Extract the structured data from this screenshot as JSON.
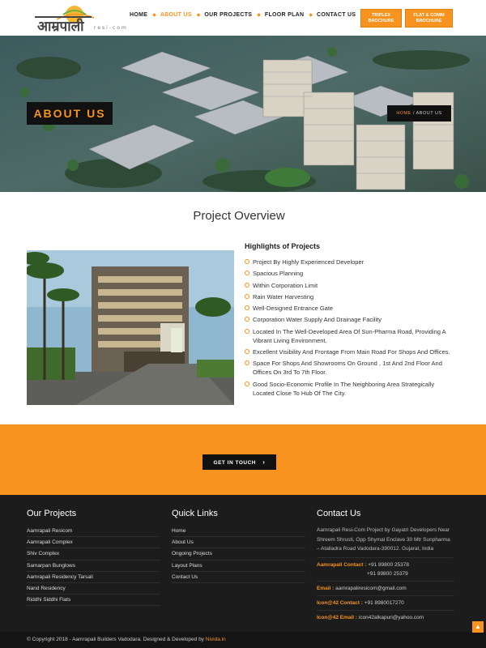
{
  "logo": {
    "text": "आम्रपाली",
    "sub": "resi-com"
  },
  "nav": [
    "HOME",
    "ABOUT US",
    "OUR PROJECTS",
    "FLOOR PLAN",
    "CONTACT US"
  ],
  "brochures": [
    {
      "line1": "TRIPLEX",
      "line2": "BROCHURE"
    },
    {
      "line1": "FLAT & COMM",
      "line2": "BROCHURE"
    }
  ],
  "hero": {
    "title": "ABOUT US",
    "crumb_home": "HOME",
    "crumb_sep": "/",
    "crumb_current": "ABOUT US"
  },
  "overview": {
    "title": "Project Overview",
    "highlights_title": "Highlights of Projects",
    "highlights": [
      "Project By Highly Experienced Developer",
      "Spacious Planning",
      "Within Corporation Limit",
      "Rain Water Harvesting",
      "Well-Designed Entrance Gate",
      "Corporation Water Supply And Drainage Facility",
      "Located In The Well-Developed Area Of Sun-Pharma Road, Providing A Vibrant Living Environment.",
      "Excellent Visibility And Frontage From Main Road For Shops And Offices.",
      "Space For Shops And Showrooms On Ground , 1st And 2nd Floor And Offices On 3rd To 7th Floor.",
      "Good Socio-Economic Profile In The Neighboring Area Strategically Located Close To Hub Of The City."
    ]
  },
  "cta": {
    "label": "GET IN TOUCH",
    "icon": "chevron-right-icon"
  },
  "footer": {
    "projects_title": "Our Projects",
    "projects": [
      "Aamrapali Resicom",
      "Aamrapali Complex",
      "Shiv Complex",
      "Samarpan Bunglows",
      "Aamrapali Residency Tarsali",
      "Nand Residency",
      "Riddhi Siddhi Flats"
    ],
    "links_title": "Quick Links",
    "links": [
      "Home",
      "About Us",
      "Ongoing Projects",
      "Layout Plans",
      "Contact Us"
    ],
    "contact_title": "Contact Us",
    "address": "Aamrapali Resi-Com Project by Gayatri Developers Near Shreem Shrusti, Opp Shymal Enclave 30 Mtr Sunpharma – Atalladra Road Vadodara-390012. Gujarat, India",
    "contact_label": "Aamrapali Contact :",
    "phone1": "+91 89800 25378",
    "phone2": "+91 89800 25379",
    "email_label": "Email :",
    "email": "aamrapaliresicom@gmail.com",
    "icon_contact_label": "Icon@42 Contact :",
    "icon_phone": "+91 8980017270",
    "icon_email_label": "Icon@42 Email :",
    "icon_email": "icon42alkapuri@yahoo.com"
  },
  "copyright": {
    "text": "© Copyright 2018 - Aamrapali Builders Vadodara. Designed & Developed by",
    "brand": "Nivida.in"
  },
  "colors": {
    "accent": "#f7931e",
    "footer": "#1c1c1c",
    "dark": "#111111"
  }
}
